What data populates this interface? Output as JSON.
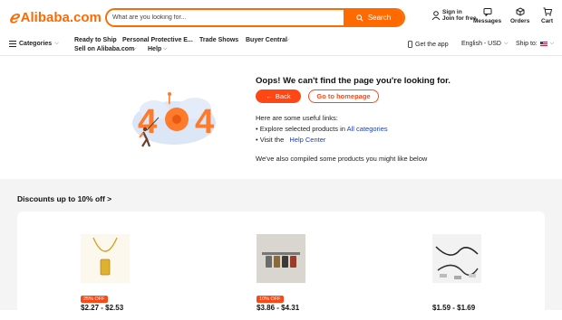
{
  "header": {
    "logo_text": "Alibaba.com",
    "search_placeholder": "What are you looking for...",
    "search_button": "Search",
    "sign_in": "Sign in",
    "join_free": "Join for free",
    "messages": "Messages",
    "orders": "Orders",
    "cart": "Cart"
  },
  "nav": {
    "categories": "Categories",
    "ready_to_ship": "Ready to Ship",
    "ppe": "Personal Protective E...",
    "trade_shows": "Trade Shows",
    "buyer_central": "Buyer Central",
    "sell": "Sell on Alibaba.com",
    "help": "Help",
    "get_app": "Get the app",
    "language": "English - USD",
    "ship_to": "Ship to:"
  },
  "error": {
    "title": "Oops! We can't find the page you're looking for.",
    "back_label": "Back",
    "home_label": "Go to homepage",
    "links_intro": "Here are some useful links:",
    "explore_prefix": "• Explore selected products in",
    "explore_link": "All categories",
    "visit_prefix": "• Visit the",
    "visit_link": "Help Center",
    "compiled": "We've also compiled some products you might like below"
  },
  "discounts": {
    "title": "Discounts up to 10% off >",
    "products": [
      {
        "badge": "25% OFF",
        "price": "$2.27 - $2.53"
      },
      {
        "badge": "10% OFF",
        "price": "$3.86 - $4.31"
      },
      {
        "badge": "",
        "price": "$1.59 - $1.69"
      }
    ]
  },
  "colors": {
    "brand": "#ff6a00",
    "accent": "#ff4715",
    "link": "#1a3eb8"
  }
}
